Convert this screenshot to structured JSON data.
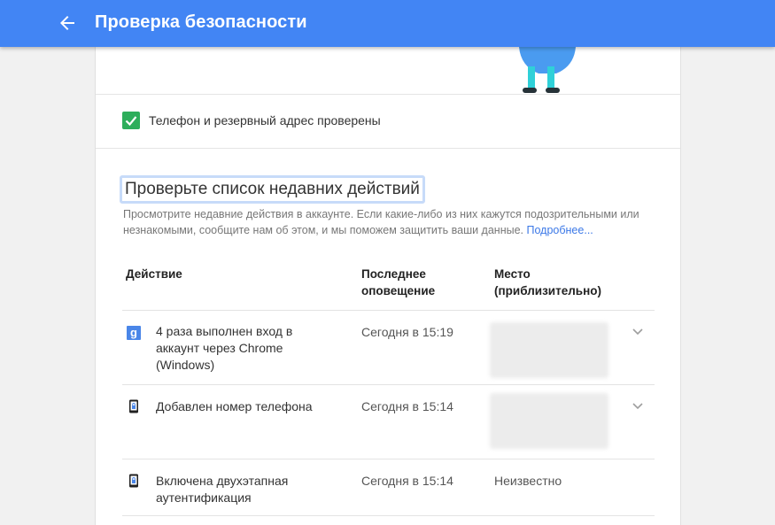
{
  "header": {
    "title": "Проверка безопасности"
  },
  "verification": {
    "text": "Телефон и резервный адрес проверены"
  },
  "recent_activity": {
    "title": "Проверьте список недавних действий",
    "description": "Просмотрите недавние действия в аккаунте. Если какие-либо из них кажутся подозрительными или незнакомыми, сообщите нам об этом, и мы поможем защитить ваши данные.",
    "more_link": "Подробнее...",
    "columns": {
      "action": "Действие",
      "last_notice": "Последнее оповещение",
      "place": "Место (приблизительно)"
    },
    "rows": [
      {
        "icon": "google-g-icon",
        "action": "4 раза выполнен вход в аккаунт через Chrome (Windows)",
        "time": "Сегодня в 15:19",
        "place": ""
      },
      {
        "icon": "phone-lock-icon",
        "action": "Добавлен номер телефона",
        "time": "Сегодня в 15:14",
        "place": ""
      },
      {
        "icon": "phone-lock-icon",
        "action": "Включена двухэтапная аутентификация",
        "time": "Сегодня в 15:14",
        "place": "Неизвестно"
      }
    ]
  },
  "colors": {
    "header_blue": "#4285f4",
    "check_green": "#2dae5b",
    "link_blue": "#3b78e7"
  }
}
